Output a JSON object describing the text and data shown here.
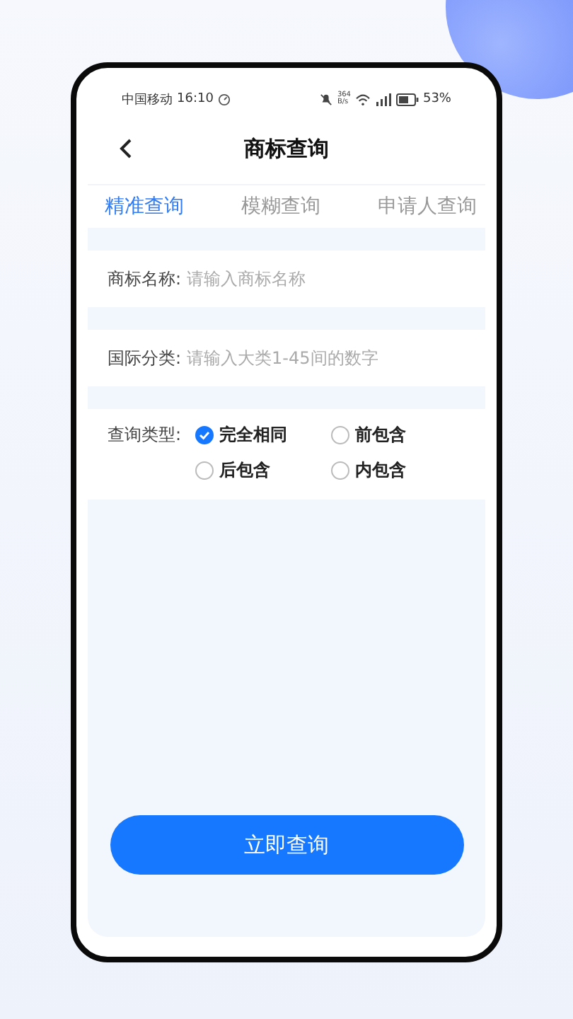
{
  "status_bar": {
    "carrier": "中国移动",
    "time": "16:10",
    "speed_value": "364",
    "speed_unit": "B/s",
    "battery": "53%"
  },
  "header": {
    "title": "商标查询"
  },
  "tabs": [
    {
      "label": "精准查询",
      "selected": true
    },
    {
      "label": "模糊查询",
      "selected": false
    },
    {
      "label": "申请人查询",
      "selected": false
    }
  ],
  "fields": [
    {
      "label": "商标名称:",
      "placeholder": "请输入商标名称"
    },
    {
      "label": "国际分类:",
      "placeholder": "请输入大类1-45间的数字"
    }
  ],
  "query_type": {
    "label": "查询类型:",
    "options": [
      {
        "label": "完全相同",
        "selected": true
      },
      {
        "label": "前包含",
        "selected": false
      },
      {
        "label": "后包含",
        "selected": false
      },
      {
        "label": "内包含",
        "selected": false
      }
    ]
  },
  "submit_button": "立即查询"
}
